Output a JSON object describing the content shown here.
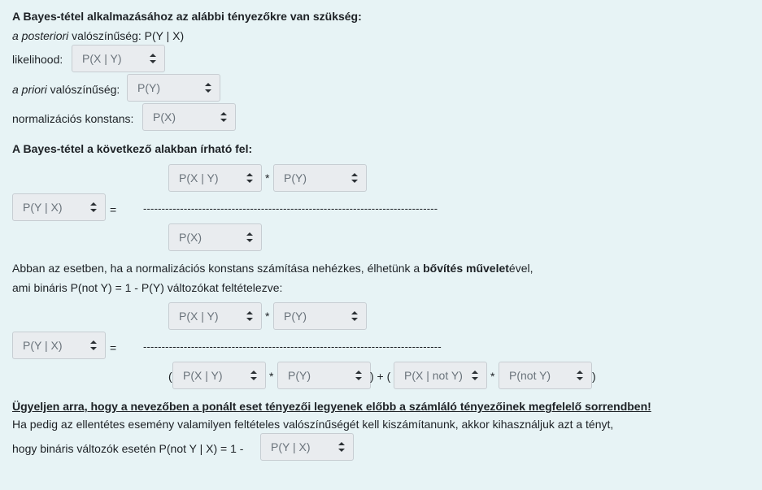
{
  "heading1": "A Bayes-tétel alkalmazásához az alábbi tényezőkre van szükség:",
  "posterior": {
    "italic": "a posteriori",
    "rest": " valószínűség: P(Y | X)"
  },
  "likelihood": {
    "label": "likelihood:",
    "value": "P(X | Y)"
  },
  "prior": {
    "italic": "a priori",
    "rest": " valószínűség:",
    "value": "P(Y)"
  },
  "normalizing": {
    "label": "normalizációs konstans:",
    "value": "P(X)"
  },
  "heading2": "A Bayes-tétel a következő alakban írható fel:",
  "eq1": {
    "num1": "P(X | Y)",
    "num2": "P(Y)",
    "den": "P(X)",
    "lhs": "P(Y | X)",
    "star": "*",
    "equals": "=",
    "dashes": "--------------------------------------------------------------------------------"
  },
  "para1": {
    "pre": "Abban az esetben, ha a normalizációs konstans számítása nehézkes, élhetünk a ",
    "bold": "bővítés művelet",
    "post": "ével,"
  },
  "para2": "ami bináris  P(not Y) = 1 - P(Y) változókat feltételezve:",
  "eq2": {
    "num1": "P(X | Y)",
    "num2": "P(Y)",
    "lhs": "P(Y | X)",
    "den1": "P(X | Y)",
    "den2": "P(Y)",
    "den3": "P(X | not Y)",
    "den4": "P(not Y)",
    "star": "*",
    "equals": "=",
    "open": "(",
    "mid": ") + (",
    "close": ")",
    "dashes": "---------------------------------------------------------------------------------"
  },
  "warning": "Ügyeljen arra, hogy  a nevezőben a ponált eset tényezői legyenek előbb a számláló tényezőinek megfelelő sorrendben!",
  "para3": "Ha pedig az ellentétes esemény valamilyen feltételes valószínűségét kell kiszámítanunk, akkor kihasználjuk azt a tényt,",
  "para4": {
    "text": "hogy bináris változók esetén P(not Y | X) = 1 - ",
    "value": "P(Y | X)"
  }
}
